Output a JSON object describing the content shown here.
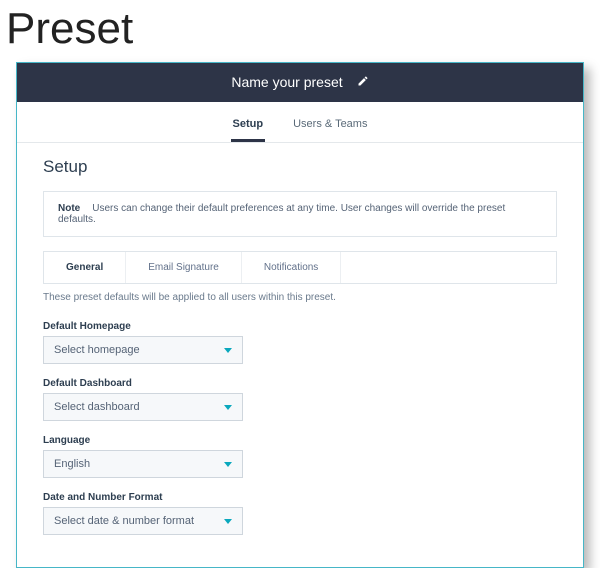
{
  "page_title": "Preset",
  "header": {
    "title": "Name your preset"
  },
  "top_tabs": {
    "setup": "Setup",
    "users": "Users & Teams"
  },
  "section_title": "Setup",
  "note": {
    "label": "Note",
    "text": "Users can change their default preferences at any time. User changes will override the preset defaults."
  },
  "inner_tabs": {
    "general": "General",
    "email": "Email Signature",
    "notifications": "Notifications"
  },
  "helper": "These preset defaults will be applied to all users within this preset.",
  "fields": {
    "homepage": {
      "label": "Default Homepage",
      "value": "Select homepage"
    },
    "dashboard": {
      "label": "Default Dashboard",
      "value": "Select dashboard"
    },
    "language": {
      "label": "Language",
      "value": "English"
    },
    "datefmt": {
      "label": "Date and Number Format",
      "value": "Select date & number format"
    }
  }
}
